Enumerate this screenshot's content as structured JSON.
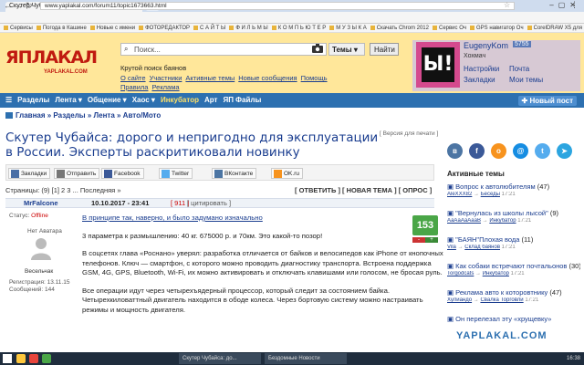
{
  "browser": {
    "tab_title": "Скутер Чубайса: дорог...",
    "url": "www.yaplakal.com/forum11/topic1673663.html",
    "bookmarks": [
      "Сервисы",
      "Погода в Кашине",
      "Новые с имени",
      "ФОТОРЕДАКТОР",
      "С А Й Т Ы",
      "Ф И Л Ь М Ы",
      "К О М П Ь Ю Т Е Р",
      "М У З Ы К А",
      "Скачать Chrom 2012",
      "Сервис Оч",
      "GPS навигатор Оч",
      "CorelDRAW X5 для"
    ]
  },
  "header": {
    "logo_text": "ЯПЛАКАЛ",
    "logo_sub": "YAPLAKAL.COM",
    "search_placeholder": "Поиск...",
    "themes_label": "Темы",
    "find_label": "Найти",
    "tagline": "Крутой поиск баянов",
    "links": [
      "О сайте",
      "Участники",
      "Активные темы",
      "Новые сообщения",
      "Помощь",
      "Правила",
      "Реклама"
    ]
  },
  "user": {
    "avatar_text": "Ы!",
    "name": "EugenyKom",
    "badge": "5755",
    "role": "Хохмач",
    "menu_left": [
      "Настройки",
      "Закладки"
    ],
    "menu_right": [
      "Почта",
      "Мои темы"
    ]
  },
  "nav": {
    "items": [
      "Разделы",
      "Лента",
      "Общение",
      "Хаос",
      "Инкубатор",
      "Арт",
      "ЯП Файлы"
    ],
    "new_post": "Новый пост"
  },
  "breadcrumbs": "Главная » Разделы » Лента » Авто/Мото",
  "post": {
    "title": "Скутер Чубайса: дорого и непригодно для эксплуатации в России. Эксперты раскритиковали новинку",
    "print_version": "[ Версия для печати ]",
    "share": [
      "Закладки",
      "Отправить",
      "Facebook",
      "Twitter",
      "ВКонтакте",
      "OK.ru"
    ],
    "pages": "Страницы: (9) [1] 2 3 ... Последняя »",
    "pages_fwd": "(9)",
    "actions": "[ ОТВЕТИТЬ ] [ НОВАЯ ТЕМА ] [ ОПРОС ]",
    "author": "MrFalcone",
    "date": "10.10.2017 - 23:41",
    "num": "[ 911 ]",
    "quote": "[ цитировать ]",
    "status_label": "Статус:",
    "status_value": "Offline",
    "no_avatar": "Нет Аватара",
    "rank": "Весельчак",
    "registration": "Регистрация: 13.11.15",
    "messages": "Сообщений: 144",
    "rating": "153",
    "minus": "-",
    "plus": "+",
    "paragraphs": [
      "В принципе так, наверно, и было задумано изначально",
      "3 параметра к размышлению: 40 кг. 675000 р. и 70км. Это какой-то позор!",
      "В соцсетях глава «Роснано» уверял: разработка отличается от байков и велосипедов как iPhone от кнопочных телефонов. Ключ — смартфон, с которого можно проводить диагностику транспорта. Встроена поддержка GSM, 4G, GPS, Bluetooth, Wi-Fi, их можно активировать и отключать клавишами или голосом, не бросая руль.",
      "Все операции идут через четырехъядерный процессор, который следит за состоянием байка. Четырехкиловаттный двигатель находится в ободе колеса. Через бортовую систему можно настраивать режимы и мощность двигателя."
    ]
  },
  "sidebar": {
    "social": [
      "vk",
      "fb",
      "ok",
      "mail",
      "tw",
      "tg"
    ],
    "active_title": "Активные темы",
    "topics": [
      {
        "title": "Вопрос к автолюбителям",
        "count": "(47)",
        "meta_user": "AleXXX82",
        "meta_sect": "Беседы",
        "time": "17:21"
      },
      {
        "title": "\"Вернулась из школы лысой\"",
        "count": "(9)",
        "meta_user": "АаАаАаАааВ",
        "meta_sect": "Инкубатор",
        "time": "17:21"
      },
      {
        "title": "\"БАЯН\"Плохая вода",
        "count": "(11)",
        "meta_user": "Vila",
        "meta_sect": "Склад баянов",
        "time": "17:21"
      },
      {
        "title": "Как собаки встречают почтальонов",
        "count": "(30)",
        "meta_user": "Torgodcats",
        "meta_sect": "Инкубатор",
        "time": "17:21"
      },
      {
        "title": "Реклама авто к которовтнику",
        "count": "(47)",
        "meta_user": "Хулиандо",
        "meta_sect": "Свалка Торговли",
        "time": "17:21"
      },
      {
        "title": "Он перелезал эту «хрущевку»",
        "count": "",
        "meta_user": "",
        "meta_sect": "",
        "time": ""
      }
    ]
  },
  "watermark": "YAPLAKAL.COM",
  "taskbar": {
    "tasks": [
      "Скутер Чубайса: до...",
      "Бездомные Новости"
    ],
    "clock": "16:38"
  }
}
